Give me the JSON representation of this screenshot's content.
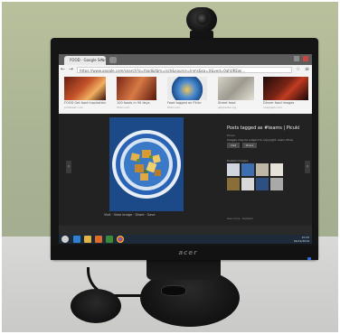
{
  "browser": {
    "tab_title": "FOOD · Google Search",
    "tab_close": "×",
    "nav_icons": "← → ⟳",
    "url": "https://www.google.com/search?q=food&tbm=isch&source=lnms&sa=X&ved=0ahUKEwj...",
    "star_icon": "☆",
    "menu_icon": "≡"
  },
  "strip": {
    "items": [
      {
        "caption": "FOOD Get food inspiration",
        "sub": "pinterest.com"
      },
      {
        "caption": "100 foods in 90 days",
        "sub": "flickr.com"
      },
      {
        "caption": "Food tagged on Flickr",
        "sub": "flickr.com"
      },
      {
        "caption": "Street food",
        "sub": "wikipedia.org"
      },
      {
        "caption": "Dinner food images",
        "sub": "unsplash.com"
      }
    ]
  },
  "viewer": {
    "left_arrow": "‹",
    "right_arrow": "›",
    "main_caption": "Visit   ·   View image   ·   Share   ·   Save",
    "title": "Posts tagged as #teams | Picuki",
    "sub": "Picuki",
    "desc": "Images may be subject to copyright. Learn More",
    "btn_visit": "Visit",
    "btn_share": "Share",
    "related_label": "Related images",
    "share_text": "See more · Related"
  },
  "taskbar": {
    "tray_time": "10:25",
    "tray_date": "04/12/2019"
  },
  "monitor": {
    "brand": "acer"
  }
}
